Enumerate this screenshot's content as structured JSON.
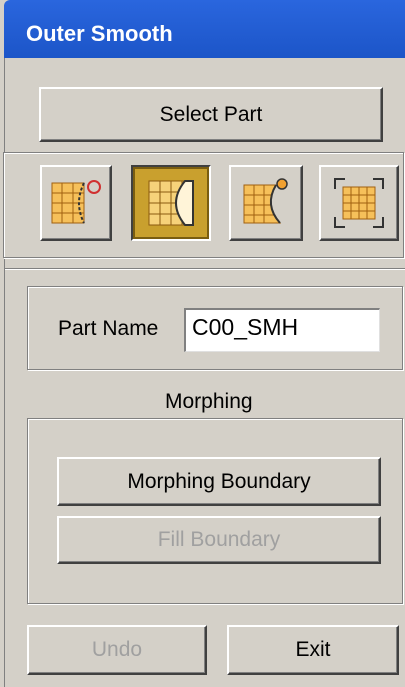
{
  "window": {
    "title": "Outer Smooth"
  },
  "select_part_label": "Select Part",
  "mode_icons": [
    {
      "name": "outer-boundary-circle-icon",
      "pressed": false
    },
    {
      "name": "inner-boundary-icon",
      "pressed": true
    },
    {
      "name": "corner-point-icon",
      "pressed": false
    },
    {
      "name": "full-surface-icon",
      "pressed": false
    }
  ],
  "part": {
    "label": "Part Name",
    "value": "C00_SMH"
  },
  "morphing": {
    "title": "Morphing",
    "boundary_label": "Morphing Boundary",
    "fill_label": "Fill Boundary"
  },
  "footer": {
    "undo_label": "Undo",
    "exit_label": "Exit"
  },
  "colors": {
    "title_bar": "#2a66de",
    "pressed_icon": "#c9a02e",
    "icon_grid": "#e8a030"
  }
}
